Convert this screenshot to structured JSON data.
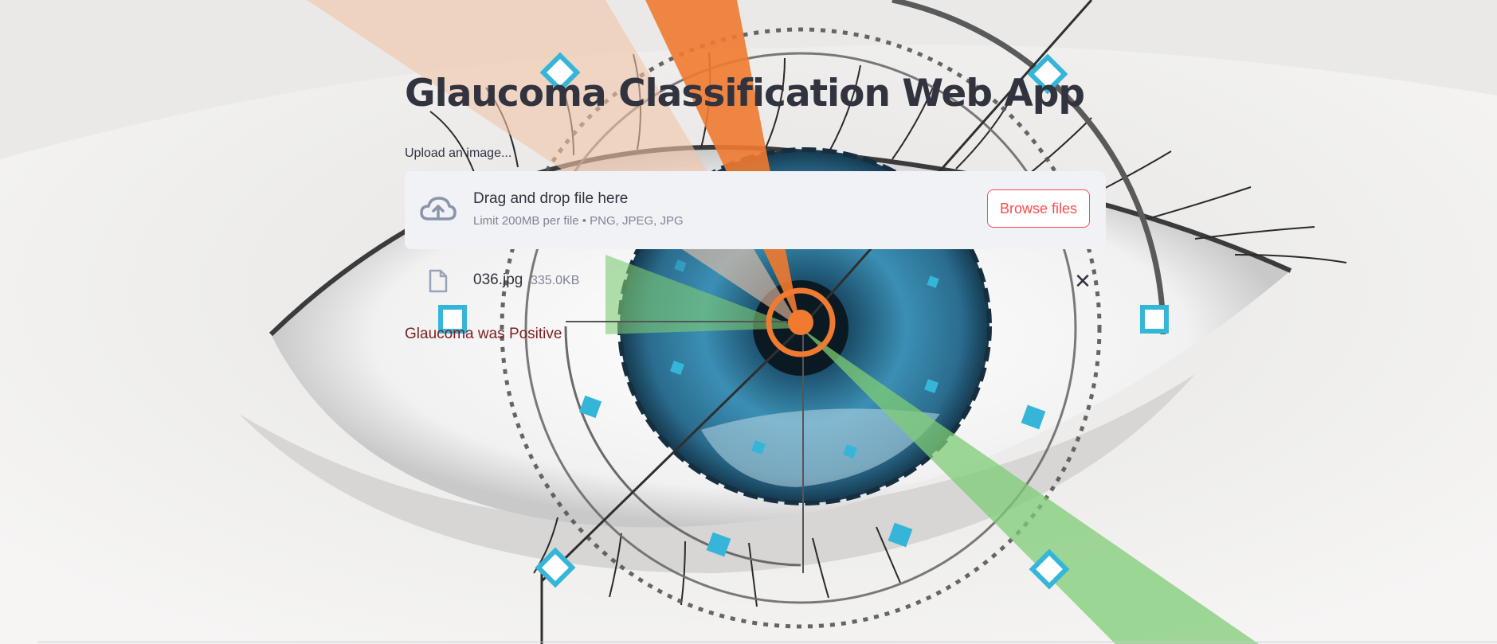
{
  "app": {
    "title": "Glaucoma Classification Web App",
    "uploader_label": "Upload an image...",
    "dropzone": {
      "title": "Drag and drop file here",
      "limit": "Limit 200MB per file • PNG, JPEG, JPG",
      "browse_label": "Browse files"
    },
    "uploaded_file": {
      "name": "036.jpg",
      "size": "335.0KB",
      "remove_symbol": "✕"
    },
    "result_text": "Glaucoma was Positive"
  },
  "icons": {
    "upload": "cloud-upload-icon",
    "file": "file-icon",
    "remove": "close-icon"
  },
  "colors": {
    "primary": "#ff4b4b",
    "text": "#31333f",
    "muted": "#808495",
    "dropzone_bg": "#f0f2f6",
    "result": "#7d1f1f",
    "iris": "#2e7ea3",
    "accent_orange": "#f07a30",
    "accent_green": "#7fcc75",
    "accent_cyan": "#35b6d8"
  }
}
